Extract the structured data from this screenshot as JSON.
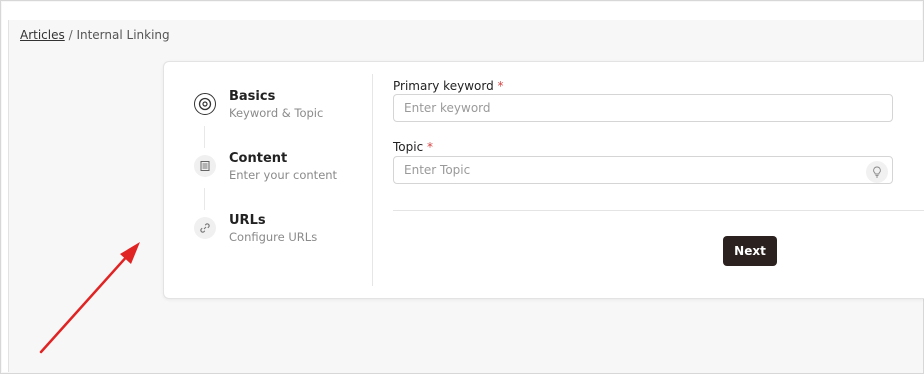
{
  "breadcrumb": {
    "link": "Articles",
    "separator": "/",
    "current": "Internal Linking"
  },
  "steps": [
    {
      "title": "Basics",
      "subtitle": "Keyword & Topic",
      "icon": "target-icon",
      "active": true
    },
    {
      "title": "Content",
      "subtitle": "Enter your content",
      "icon": "document-icon",
      "active": false
    },
    {
      "title": "URLs",
      "subtitle": "Configure URLs",
      "icon": "link-icon",
      "active": false
    }
  ],
  "form": {
    "keyword": {
      "label": "Primary keyword",
      "required_mark": "*",
      "placeholder": "Enter keyword",
      "value": ""
    },
    "topic": {
      "label": "Topic",
      "required_mark": "*",
      "placeholder": "Enter Topic",
      "value": "",
      "suggest_icon": "lightbulb-icon"
    },
    "next_label": "Next"
  },
  "colors": {
    "primary_button": "#2b211f",
    "required": "#d64545",
    "annotation_arrow": "#e02424"
  }
}
